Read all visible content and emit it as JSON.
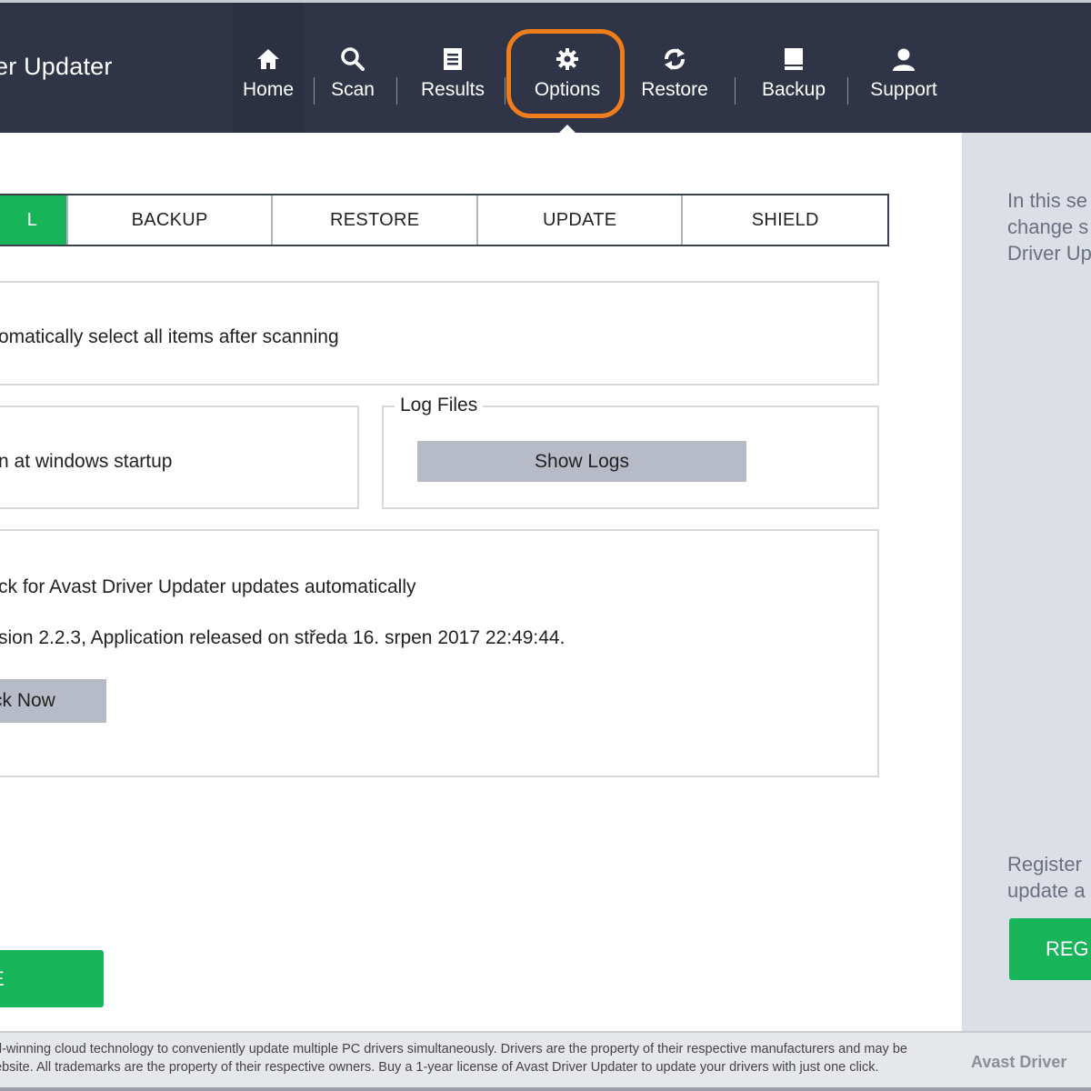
{
  "header": {
    "app_title": "er Updater",
    "nav": [
      {
        "label": "Home",
        "icon": "home-icon"
      },
      {
        "label": "Scan",
        "icon": "search-icon"
      },
      {
        "label": "Results",
        "icon": "document-icon"
      },
      {
        "label": "Options",
        "icon": "gear-icon"
      },
      {
        "label": "Restore",
        "icon": "refresh-icon"
      },
      {
        "label": "Backup",
        "icon": "drive-icon"
      },
      {
        "label": "Support",
        "icon": "user-icon"
      }
    ],
    "active_item": "Options",
    "highlight_color": "#f07d1b"
  },
  "tabs": [
    "L",
    "BACKUP",
    "RESTORE",
    "UPDATE",
    "SHIELD"
  ],
  "scan_panel": {
    "text": "omatically select all items after scanning"
  },
  "startup_panel": {
    "text": "n at windows startup"
  },
  "log_panel": {
    "legend": "Log Files",
    "button": "Show Logs"
  },
  "update_panel": {
    "auto_text": "ck for Avast Driver Updater updates automatically",
    "version_text": "sion 2.2.3, Application released on středa 16. srpen 2017 22:49:44.",
    "check_button": "ck Now"
  },
  "save_button": "E",
  "sidebar": {
    "info_text": "In this se\nchange s\nDriver Up",
    "register_text": "Register\nupdate a",
    "register_button": "REG"
  },
  "footer": {
    "text": "d-winning cloud technology to conveniently update multiple PC drivers simultaneously. Drivers are the property of their respective manufacturers and may be\nebsite. All trademarks are the property of their respective owners. Buy a 1-year license of Avast Driver Updater to update your drivers with just one click.",
    "brand": "Avast Driver"
  },
  "colors": {
    "header_bg": "#2f3546",
    "accent_green": "#18b45a",
    "sidebar_bg": "#dcdfe6",
    "button_gray": "#b7bbc7"
  }
}
